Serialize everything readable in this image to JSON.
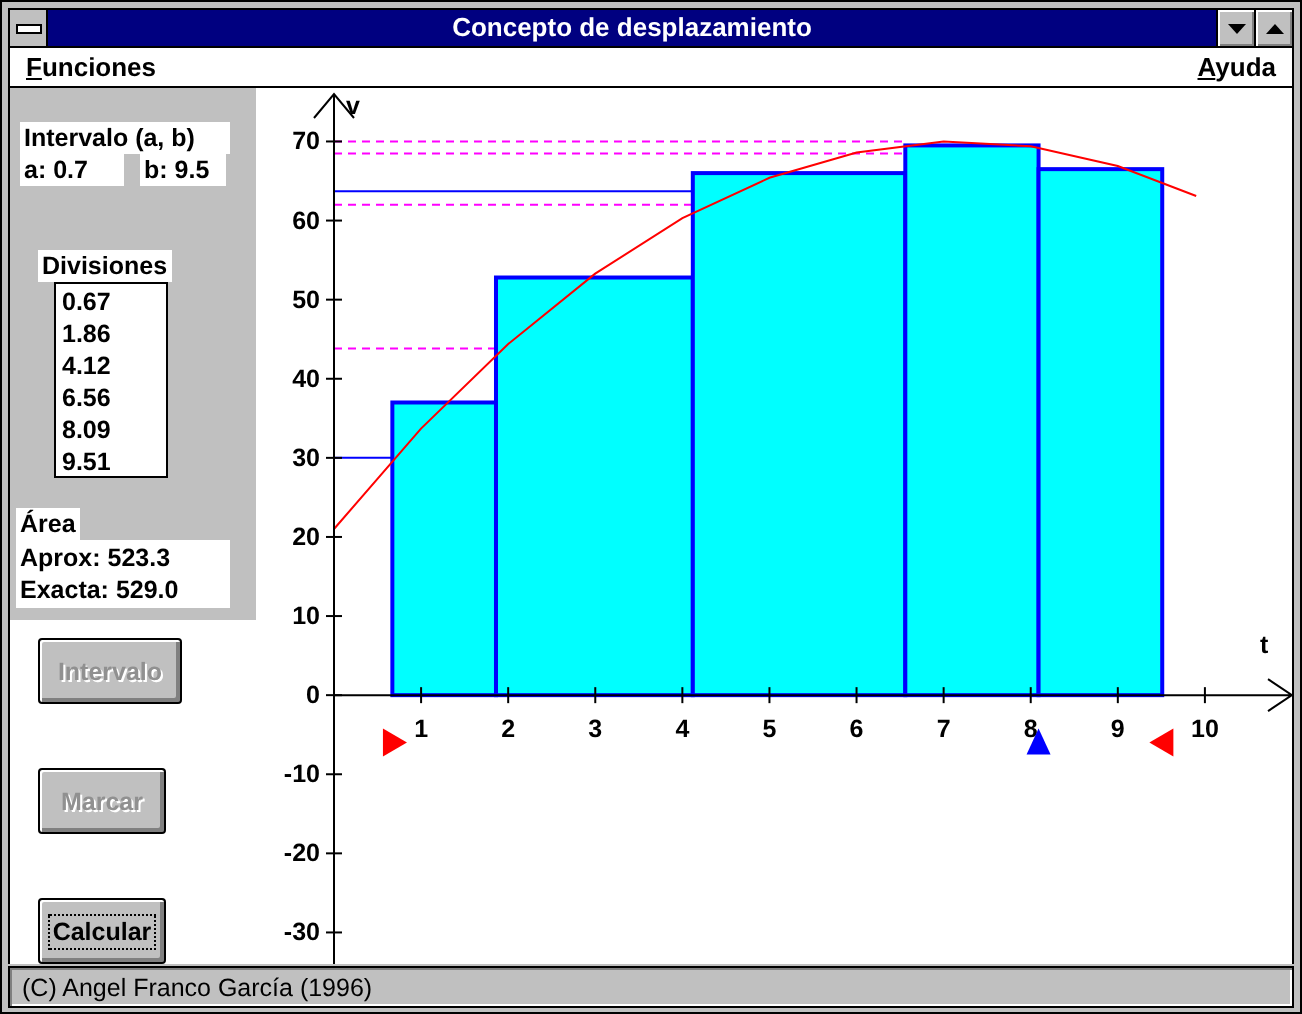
{
  "window": {
    "title": "Concepto de desplazamiento"
  },
  "menu": [
    {
      "label": "Funciones"
    },
    {
      "label": "Ayuda"
    }
  ],
  "interval": {
    "title": "Intervalo (a, b)",
    "a": "a: 0.7",
    "b": "b: 9.5"
  },
  "divisions": {
    "title": "Divisiones",
    "items": [
      "0.67",
      "1.86",
      "4.12",
      "6.56",
      "8.09",
      "9.51"
    ]
  },
  "area": {
    "title": "Área",
    "approx": "Aprox: 523.3",
    "exact": "Exacta: 529.0"
  },
  "buttons": [
    {
      "label": "Intervalo",
      "disabled": true,
      "focused": false
    },
    {
      "label": "Marcar",
      "disabled": true,
      "focused": false
    },
    {
      "label": "Calcular",
      "disabled": false,
      "focused": true
    }
  ],
  "chart": {
    "chart_data": {
      "type": "bar",
      "xlabel": "t",
      "ylabel": "v",
      "x": [
        1.265,
        2.99,
        5.34,
        7.325,
        8.8
      ],
      "series": [
        {
          "color": "#00ffff",
          "values": [
            37,
            52.8,
            66,
            69.5,
            66.5
          ]
        },
        {
          "type": "line",
          "color": "#ff0000",
          "x": [
            0,
            1,
            2,
            3,
            4,
            5,
            6,
            7,
            8,
            9,
            9.9
          ],
          "values": [
            21,
            33.7,
            44.4,
            53.3,
            60.3,
            65.4,
            68.6,
            70,
            69.4,
            66.9,
            63.1
          ]
        },
        {
          "type": "scatter",
          "color": "#ff0000",
          "x": [
            0.7,
            9.5
          ],
          "values": [
            -6,
            -6
          ]
        },
        {
          "type": "scatter",
          "color": "#0000ff",
          "x": [
            8.09
          ],
          "values": [
            -6
          ]
        },
        {
          "type": "line",
          "color": "#0000ff",
          "x": [
            0,
            0.67
          ],
          "values": [
            30,
            30
          ]
        },
        {
          "type": "line",
          "color": "#0000ff",
          "x": [
            0,
            4.12
          ],
          "values": [
            63.7,
            63.7
          ]
        },
        {
          "type": "line",
          "line_style": "dashed",
          "color": "#ff00ff",
          "x": [
            0,
            1.86
          ],
          "values": [
            43.8,
            43.8
          ]
        },
        {
          "type": "line",
          "line_style": "dashed",
          "color": "#ff00ff",
          "x": [
            0,
            4.12
          ],
          "values": [
            62,
            62
          ]
        },
        {
          "type": "line",
          "line_style": "dashed",
          "color": "#ff00ff",
          "x": [
            0,
            6.56
          ],
          "values": [
            68.5,
            68.5
          ]
        },
        {
          "type": "line",
          "line_style": "dashed",
          "color": "#ff00ff",
          "x": [
            0,
            6.56
          ],
          "values": [
            70,
            70
          ]
        }
      ],
      "xlim": [
        0,
        11
      ],
      "ylim": [
        -35,
        76
      ],
      "xticks": [
        1,
        2,
        3,
        4,
        5,
        6,
        7,
        8,
        9,
        10
      ],
      "yticks": [
        -30,
        -20,
        -10,
        0,
        10,
        20,
        30,
        40,
        50,
        60,
        70
      ]
    }
  },
  "status_bar": "(C) Angel Franco García (1996)"
}
